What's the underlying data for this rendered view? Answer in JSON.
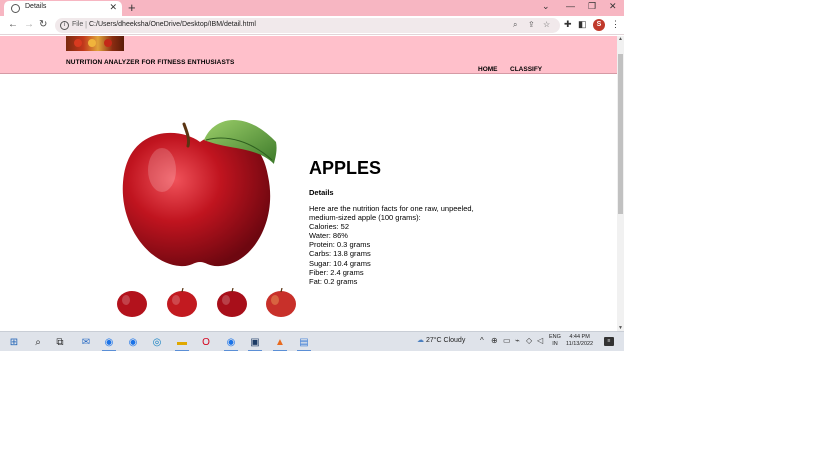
{
  "browser": {
    "tab_title": "Details",
    "url_prefix": "File",
    "url": "C:/Users/dheeksha/OneDrive/Desktop/IBM/detail.html",
    "profile_initial": "S"
  },
  "site": {
    "title": "NUTRITION ANALYZER FOR FITNESS ENTHUSIASTS",
    "nav": [
      "HOME",
      "CLASSIFY"
    ]
  },
  "fruit": {
    "name": "APPLES",
    "details_heading": "Details",
    "intro_line1": "Here are the nutrition facts for one raw, unpeeled,",
    "intro_line2": "medium-sized apple (100 grams):",
    "facts": [
      "Calories: 52",
      "Water: 86%",
      "Protein: 0.3 grams",
      "Carbs: 13.8 grams",
      "Sugar: 10.4 grams",
      "Fiber: 2.4 grams",
      "Fat: 0.2 grams"
    ]
  },
  "taskbar": {
    "weather": "27°C  Cloudy",
    "lang_line1": "ENG",
    "lang_line2": "IN",
    "time": "4:44 PM",
    "date": "11/13/2022"
  },
  "colors": {
    "header_pink": "#ffc0cb",
    "tabstrip_pink": "#f7b6c2",
    "apple_red": "#b3121c"
  }
}
